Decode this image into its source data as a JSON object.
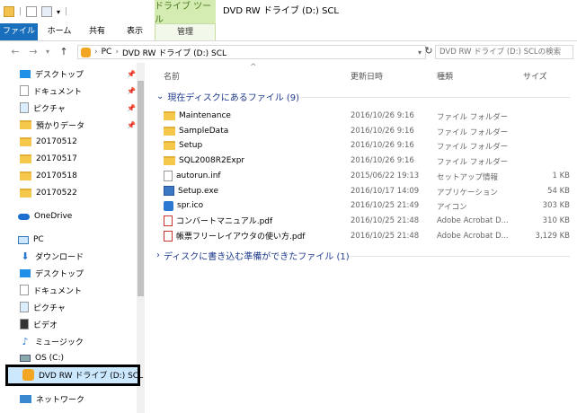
{
  "window": {
    "title": "DVD RW ドライブ (D:) SCL"
  },
  "ribbon": {
    "context_group": "ドライブ ツール",
    "tabs": [
      "ファイル",
      "ホーム",
      "共有",
      "表示",
      "管理"
    ]
  },
  "address": {
    "path": [
      "PC",
      "DVD RW ドライブ (D:) SCL"
    ],
    "search_placeholder": "DVD RW ドライブ (D:) SCLの検索"
  },
  "sidebar": {
    "quick_access": [
      {
        "label": "デスクトップ",
        "icon": "desktop-icon",
        "pinned": true
      },
      {
        "label": "ドキュメント",
        "icon": "document-icon",
        "pinned": true
      },
      {
        "label": "ピクチャ",
        "icon": "pictures-icon",
        "pinned": true
      },
      {
        "label": "預かりデータ",
        "icon": "folder-icon",
        "pinned": true
      },
      {
        "label": "20170512",
        "icon": "folder-icon"
      },
      {
        "label": "20170517",
        "icon": "folder-icon"
      },
      {
        "label": "20170518",
        "icon": "folder-icon"
      },
      {
        "label": "20170522",
        "icon": "folder-icon"
      }
    ],
    "onedrive": "OneDrive",
    "pc": "PC",
    "pc_items": [
      {
        "label": "ダウンロード",
        "icon": "download-icon"
      },
      {
        "label": "デスクトップ",
        "icon": "desktop-icon"
      },
      {
        "label": "ドキュメント",
        "icon": "document-icon"
      },
      {
        "label": "ピクチャ",
        "icon": "pictures-icon"
      },
      {
        "label": "ビデオ",
        "icon": "video-icon"
      },
      {
        "label": "ミュージック",
        "icon": "music-icon"
      },
      {
        "label": "OS (C:)",
        "icon": "disk-icon"
      },
      {
        "label": "DVD RW ドライブ (D:) SCL",
        "icon": "dvd-icon"
      }
    ],
    "network": "ネットワーク"
  },
  "columns": {
    "name": "名前",
    "date": "更新日時",
    "type": "種類",
    "size": "サイズ"
  },
  "groups": {
    "current": "現在ディスクにあるファイル (9)",
    "pending": "ディスクに書き込む準備ができたファイル (1)"
  },
  "files": [
    {
      "name": "Maintenance",
      "date": "2016/10/26 9:16",
      "type": "ファイル フォルダー",
      "size": "",
      "icon": "folder"
    },
    {
      "name": "SampleData",
      "date": "2016/10/26 9:16",
      "type": "ファイル フォルダー",
      "size": "",
      "icon": "folder"
    },
    {
      "name": "Setup",
      "date": "2016/10/26 9:16",
      "type": "ファイル フォルダー",
      "size": "",
      "icon": "folder"
    },
    {
      "name": "SQL2008R2Expr",
      "date": "2016/10/26 9:16",
      "type": "ファイル フォルダー",
      "size": "",
      "icon": "folder"
    },
    {
      "name": "autorun.inf",
      "date": "2015/06/22 19:13",
      "type": "セットアップ情報",
      "size": "1 KB",
      "icon": "doc"
    },
    {
      "name": "Setup.exe",
      "date": "2016/10/17 14:09",
      "type": "アプリケーション",
      "size": "54 KB",
      "icon": "exe"
    },
    {
      "name": "spr.ico",
      "date": "2016/10/25 21:49",
      "type": "アイコン",
      "size": "303 KB",
      "icon": "ico"
    },
    {
      "name": "コンバートマニュアル.pdf",
      "date": "2016/10/25 21:48",
      "type": "Adobe Acrobat D...",
      "size": "310 KB",
      "icon": "pdf"
    },
    {
      "name": "帳票フリーレイアウタの使い方.pdf",
      "date": "2016/10/25 21:48",
      "type": "Adobe Acrobat D...",
      "size": "3,129 KB",
      "icon": "pdf"
    }
  ]
}
